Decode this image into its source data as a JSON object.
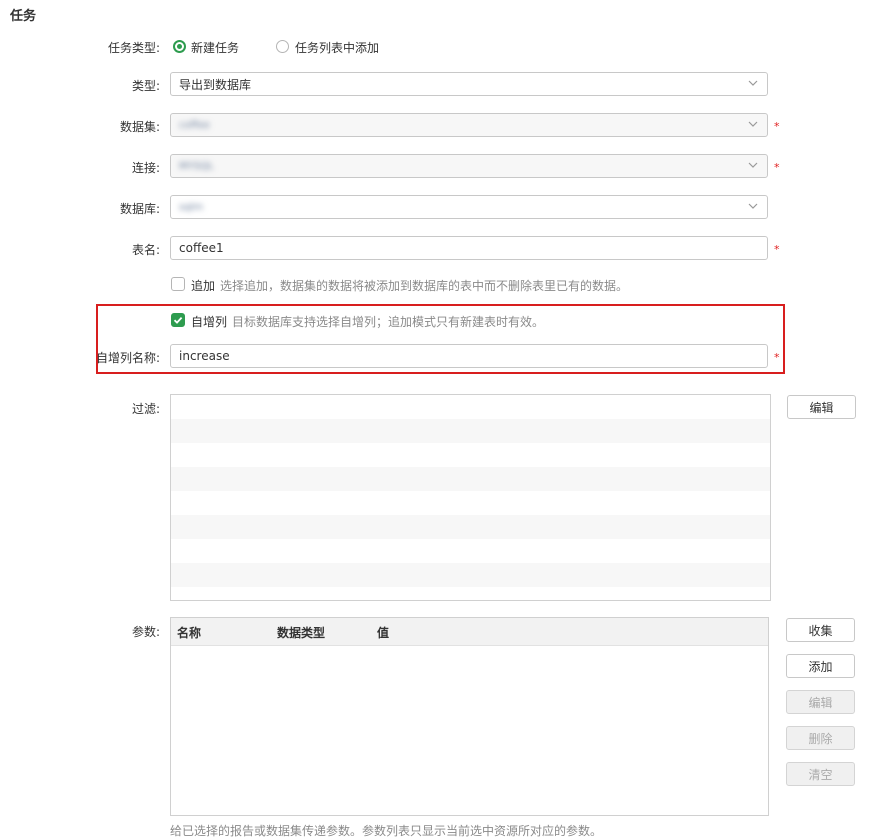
{
  "section_title": "任务",
  "task_type": {
    "label": "任务类型:",
    "options": [
      {
        "label": "新建任务",
        "selected": true
      },
      {
        "label": "任务列表中添加",
        "selected": false
      }
    ]
  },
  "type": {
    "label": "类型:",
    "value": "导出到数据库"
  },
  "dataset": {
    "label": "数据集:",
    "value": "coffee",
    "required": "*"
  },
  "connection": {
    "label": "连接:",
    "value": "MYSQL",
    "required": "*"
  },
  "database": {
    "label": "数据库:",
    "value": "sqlm"
  },
  "table_name": {
    "label": "表名:",
    "value": "coffee1",
    "required": "*"
  },
  "append": {
    "label": "追加",
    "checked": false,
    "hint": "选择追加，数据集的数据将被添加到数据库的表中而不删除表里已有的数据。"
  },
  "auto_increment": {
    "label": "自增列",
    "checked": true,
    "hint": "目标数据库支持选择自增列；追加模式只有新建表时有效。"
  },
  "auto_increment_name": {
    "label": "自增列名称:",
    "value": "increase",
    "required": "*"
  },
  "filter": {
    "label": "过滤:",
    "edit_button": "编辑"
  },
  "params": {
    "label": "参数:",
    "columns": [
      "名称",
      "数据类型",
      "值"
    ],
    "buttons": {
      "collect": "收集",
      "add": "添加",
      "edit": "编辑",
      "delete": "删除",
      "clear": "清空"
    },
    "footnote": "给已选择的报告或数据集传递参数。参数列表只显示当前选中资源所对应的参数。"
  },
  "colors": {
    "accent": "#2e9c4f",
    "highlight_border": "#d81e1e",
    "required": "#e02020"
  }
}
